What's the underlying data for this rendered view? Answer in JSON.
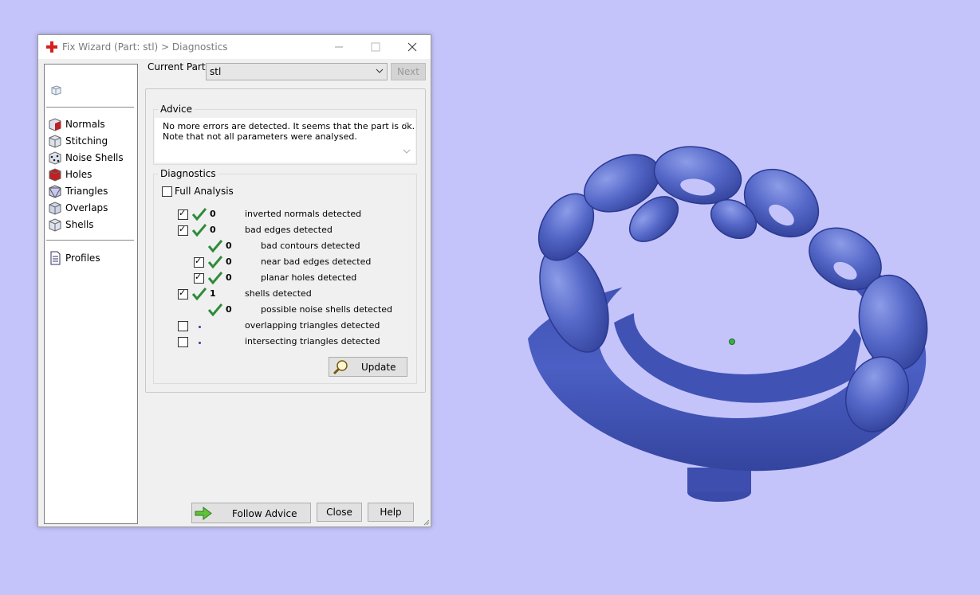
{
  "window": {
    "title": "Fix Wizard (Part: stl) > Diagnostics"
  },
  "sidebar": {
    "items": [
      {
        "label": "Normals",
        "icon": "normals-icon"
      },
      {
        "label": "Stitching",
        "icon": "stitching-icon"
      },
      {
        "label": "Noise Shells",
        "icon": "noise-shells-icon"
      },
      {
        "label": "Holes",
        "icon": "holes-icon"
      },
      {
        "label": "Triangles",
        "icon": "triangles-icon"
      },
      {
        "label": "Overlaps",
        "icon": "overlaps-icon"
      },
      {
        "label": "Shells",
        "icon": "shells-icon"
      }
    ],
    "profiles_label": "Profiles"
  },
  "current_part": {
    "label": "Current Part:",
    "value": "stl",
    "next_label": "Next"
  },
  "advice": {
    "title": "Advice",
    "line1": "No more errors are detected. It seems that the part is ok.",
    "line2": "Note that not all parameters were analysed."
  },
  "diagnostics": {
    "title": "Diagnostics",
    "full_analysis_label": "Full Analysis",
    "full_analysis_checked": false,
    "rows": [
      {
        "checkbox": true,
        "checked": true,
        "ok": true,
        "count": "0",
        "label": "inverted normals detected",
        "indent": 0
      },
      {
        "checkbox": true,
        "checked": true,
        "ok": true,
        "count": "0",
        "label": "bad edges detected",
        "indent": 0
      },
      {
        "checkbox": false,
        "checked": false,
        "ok": true,
        "count": "0",
        "label": "bad contours detected",
        "indent": 1
      },
      {
        "checkbox": true,
        "checked": true,
        "ok": true,
        "count": "0",
        "label": "near bad edges detected",
        "indent": 1
      },
      {
        "checkbox": true,
        "checked": true,
        "ok": true,
        "count": "0",
        "label": "planar holes detected",
        "indent": 1
      },
      {
        "checkbox": true,
        "checked": true,
        "ok": true,
        "count": "1",
        "label": "shells detected",
        "indent": 0
      },
      {
        "checkbox": false,
        "checked": false,
        "ok": true,
        "count": "0",
        "label": "possible noise shells detected",
        "indent": 1
      },
      {
        "checkbox": true,
        "checked": false,
        "ok": false,
        "count": "",
        "label": "overlapping triangles detected",
        "indent": 0
      },
      {
        "checkbox": true,
        "checked": false,
        "ok": false,
        "count": "",
        "label": "intersecting triangles detected",
        "indent": 0
      }
    ],
    "update_label": "Update"
  },
  "buttons": {
    "follow_advice": "Follow Advice",
    "close": "Close",
    "help": "Help"
  },
  "colors": {
    "desktop": "#c4c4fb",
    "model": "#4b5fbf",
    "check": "#2e8b3a",
    "pivot": "#3cb043"
  }
}
